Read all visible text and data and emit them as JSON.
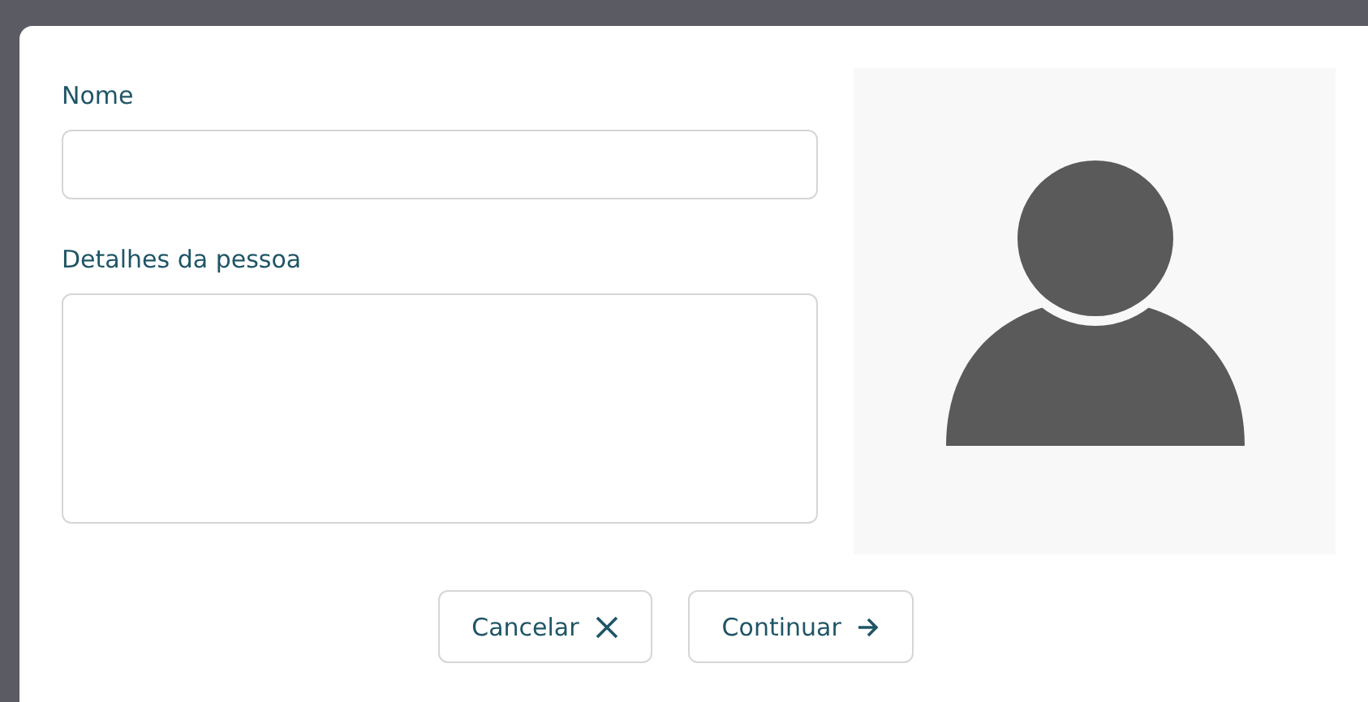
{
  "form": {
    "fields": [
      {
        "label": "Nome",
        "kind": "input"
      },
      {
        "label": "Detalhes da pessoa",
        "kind": "textarea"
      }
    ]
  },
  "photo": {
    "kind": "avatar"
  },
  "buttons": [
    {
      "label": "Cancelar",
      "kind": "cancel"
    },
    {
      "label": "Continuar",
      "kind": "continue"
    }
  ]
}
